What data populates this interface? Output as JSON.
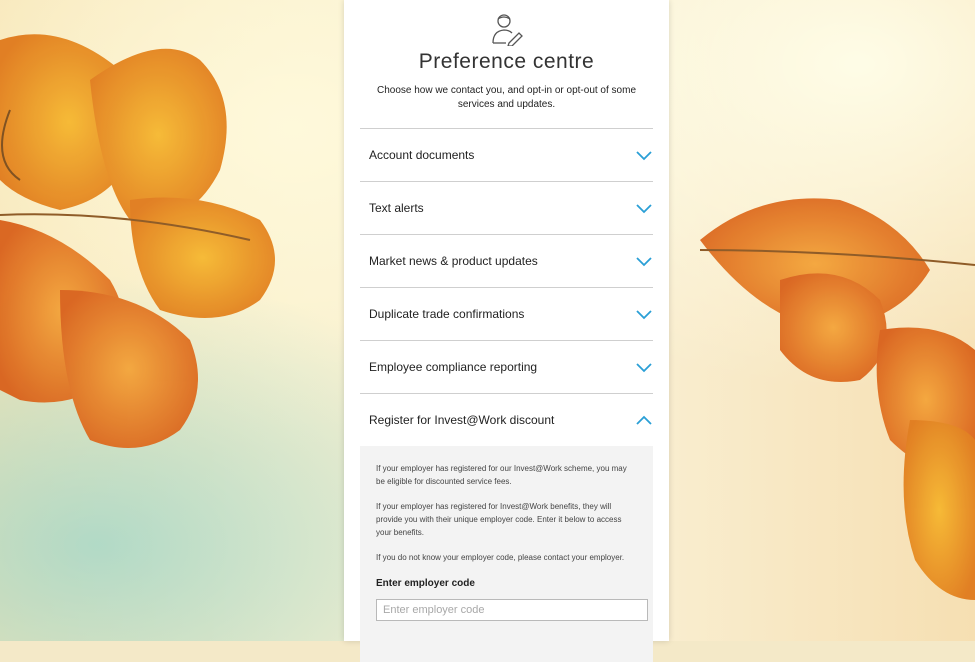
{
  "header": {
    "title": "Preference centre",
    "subtitle": "Choose how we contact you, and opt-in or opt-out of some services and updates."
  },
  "sections": [
    {
      "label": "Account documents",
      "expanded": false
    },
    {
      "label": "Text alerts",
      "expanded": false
    },
    {
      "label": "Market news & product updates",
      "expanded": false
    },
    {
      "label": "Duplicate trade confirmations",
      "expanded": false
    },
    {
      "label": "Employee compliance reporting",
      "expanded": false
    },
    {
      "label": "Register for Invest@Work discount",
      "expanded": true
    }
  ],
  "invest_work": {
    "para1": "If your employer has registered for our Invest@Work scheme, you may be eligible for discounted service fees.",
    "para2": "If your employer has registered for Invest@Work benefits, they will provide you with their unique employer code. Enter it below to access your benefits.",
    "para3": "If you do not know your employer code, please contact your employer.",
    "code_label": "Enter employer code",
    "code_placeholder": "Enter employer code",
    "code_value": ""
  },
  "icons": {
    "header": "user-edit-icon",
    "collapsed": "chevron-down-icon",
    "expanded": "chevron-up-icon"
  },
  "colors": {
    "accent": "#2a9fd6",
    "text": "#222222",
    "divider": "#cfcfcf",
    "panel_bg": "#ffffff",
    "details_bg": "#f3f3f3"
  }
}
